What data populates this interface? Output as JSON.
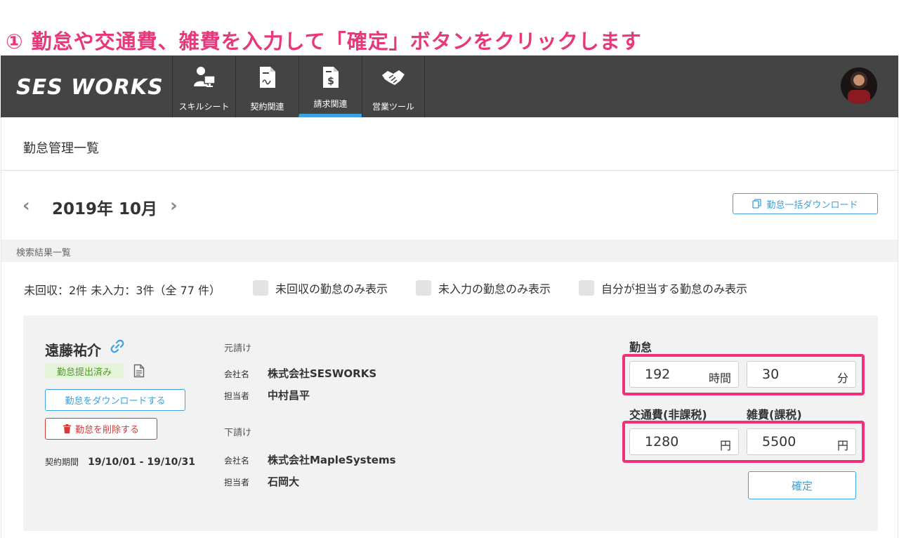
{
  "instruction": "① 勤怠や交通費、雑費を入力して「確定」ボタンをクリックします",
  "nav": {
    "logo": "SES WORKS",
    "items": [
      {
        "label": "スキルシート",
        "icon": "person-monitor-icon"
      },
      {
        "label": "契約関連",
        "icon": "contract-document-icon"
      },
      {
        "label": "請求関連",
        "icon": "invoice-dollar-icon"
      },
      {
        "label": "営業ツール",
        "icon": "handshake-icon"
      }
    ],
    "active_index": 2
  },
  "page": {
    "title": "勤怠管理一覧",
    "month": "2019年 10月",
    "bulk_download_label": "勤怠一括ダウンロード",
    "results_label": "検索結果一覧",
    "summary": "未回収：2件  未入力：3件（全 77 件）",
    "filters": [
      {
        "label": "未回収の勤怠のみ表示",
        "checked": false
      },
      {
        "label": "未入力の勤怠のみ表示",
        "checked": false
      },
      {
        "label": "自分が担当する勤怠のみ表示",
        "checked": false
      }
    ]
  },
  "card": {
    "name": "遠藤祐介",
    "status_badge": "勤怠提出済み",
    "download_label": "勤怠をダウンロードする",
    "delete_label": "勤怠を削除する",
    "period_label": "契約期間",
    "period_value": "19/10/01 - 19/10/31",
    "upstream": {
      "heading": "元請け",
      "company_label": "会社名",
      "company": "株式会社SESWORKS",
      "manager_label": "担当者",
      "manager": "中村昌平"
    },
    "downstream": {
      "heading": "下請け",
      "company_label": "会社名",
      "company": "株式会社MapleSystems",
      "manager_label": "担当者",
      "manager": "石岡大"
    },
    "attendance": {
      "label": "勤怠",
      "hours": "192",
      "hours_unit": "時間",
      "minutes": "30",
      "minutes_unit": "分"
    },
    "transport": {
      "label": "交通費(非課税)",
      "value": "1280",
      "unit": "円"
    },
    "misc": {
      "label": "雑費(課税)",
      "value": "5500",
      "unit": "円"
    },
    "confirm_label": "確定"
  },
  "colors": {
    "highlight": "#f2307a",
    "accent": "#3ea1db",
    "danger": "#d83a3a",
    "navbar": "#444444"
  }
}
